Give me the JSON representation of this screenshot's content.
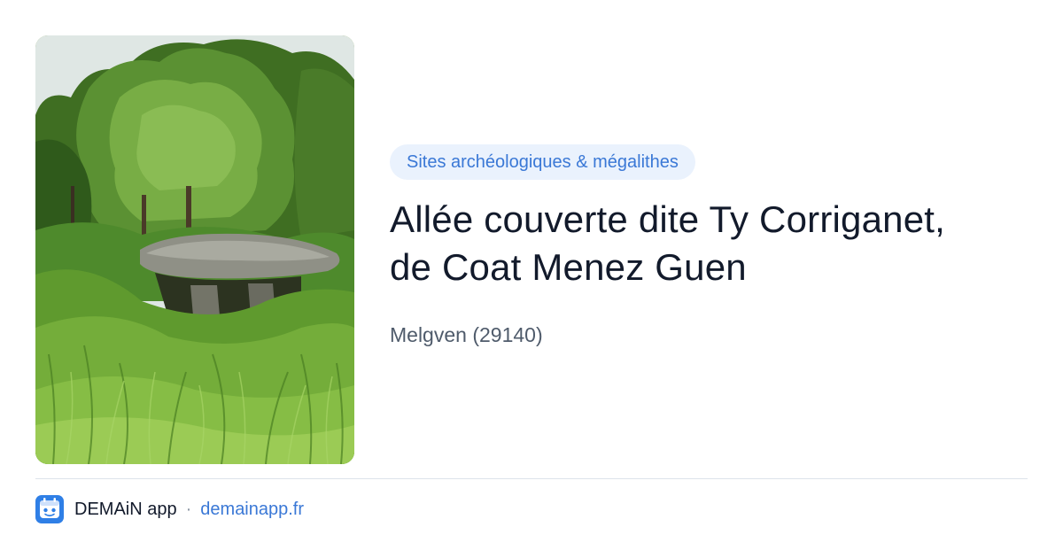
{
  "card": {
    "image_alt": "Dolmen couvert de végétation",
    "category": "Sites archéologiques & mégalithes",
    "title_line1": "Allée couverte dite Ty Corriganet,",
    "title_line2": "de Coat Menez Guen",
    "location": "Melgven (29140)"
  },
  "footer": {
    "logo_icon": "demain-app-logo-icon",
    "app_name": "DEMAiN app",
    "separator": "·",
    "domain": "demainapp.fr"
  },
  "colors": {
    "accent": "#3a78d6",
    "chip_background": "#eaf2fd",
    "title": "#121a2b",
    "muted": "#4f5b6b",
    "divider": "#dde3ea"
  }
}
